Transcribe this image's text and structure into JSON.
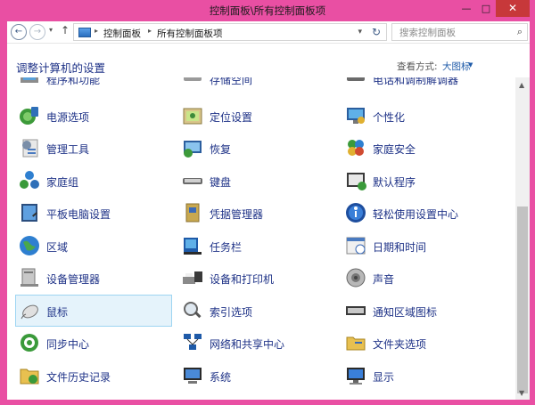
{
  "window": {
    "title": "控制面板\\所有控制面板项",
    "minimize": "—",
    "maximize": "□",
    "close": "✕"
  },
  "nav": {
    "back": "←",
    "forward": "→",
    "recent": "▾",
    "up": "↑",
    "crumbs": [
      "控制面板",
      "所有控制面板项"
    ],
    "separator": "▸",
    "address_dropdown": "▾",
    "refresh": "↻",
    "search_placeholder": "搜索控制面板",
    "search_icon": "⌕"
  },
  "header": {
    "title": "调整计算机的设置",
    "view_by_label": "查看方式:",
    "view_by_value": "大图标",
    "view_by_arrow": "▼"
  },
  "colors": {
    "accent_border": "#e94fa3",
    "title_link": "#1e3287",
    "selected_bg": "#e5f3fb"
  },
  "items": [
    {
      "label": "程序和功能",
      "icon": "programs-icon"
    },
    {
      "label": "存储空间",
      "icon": "storage-icon"
    },
    {
      "label": "电话和调制解调器",
      "icon": "phone-modem-icon"
    },
    {
      "label": "电源选项",
      "icon": "power-icon"
    },
    {
      "label": "定位设置",
      "icon": "location-icon"
    },
    {
      "label": "个性化",
      "icon": "personalize-icon"
    },
    {
      "label": "管理工具",
      "icon": "admin-tools-icon"
    },
    {
      "label": "恢复",
      "icon": "recovery-icon"
    },
    {
      "label": "家庭安全",
      "icon": "family-safety-icon"
    },
    {
      "label": "家庭组",
      "icon": "homegroup-icon"
    },
    {
      "label": "键盘",
      "icon": "keyboard-icon"
    },
    {
      "label": "默认程序",
      "icon": "default-programs-icon"
    },
    {
      "label": "平板电脑设置",
      "icon": "tablet-icon"
    },
    {
      "label": "凭据管理器",
      "icon": "credential-icon"
    },
    {
      "label": "轻松使用设置中心",
      "icon": "ease-of-access-icon"
    },
    {
      "label": "区域",
      "icon": "region-icon"
    },
    {
      "label": "任务栏",
      "icon": "taskbar-icon"
    },
    {
      "label": "日期和时间",
      "icon": "datetime-icon"
    },
    {
      "label": "设备管理器",
      "icon": "device-manager-icon"
    },
    {
      "label": "设备和打印机",
      "icon": "printer-icon"
    },
    {
      "label": "声音",
      "icon": "sound-icon"
    },
    {
      "label": "鼠标",
      "icon": "mouse-icon"
    },
    {
      "label": "索引选项",
      "icon": "index-icon"
    },
    {
      "label": "通知区域图标",
      "icon": "notify-icon"
    },
    {
      "label": "同步中心",
      "icon": "sync-icon"
    },
    {
      "label": "网络和共享中心",
      "icon": "network-icon"
    },
    {
      "label": "文件夹选项",
      "icon": "folder-options-icon"
    },
    {
      "label": "文件历史记录",
      "icon": "file-history-icon"
    },
    {
      "label": "系统",
      "icon": "system-icon"
    },
    {
      "label": "显示",
      "icon": "display-icon"
    }
  ],
  "scrollbar": {
    "up": "▲",
    "down": "▼"
  }
}
